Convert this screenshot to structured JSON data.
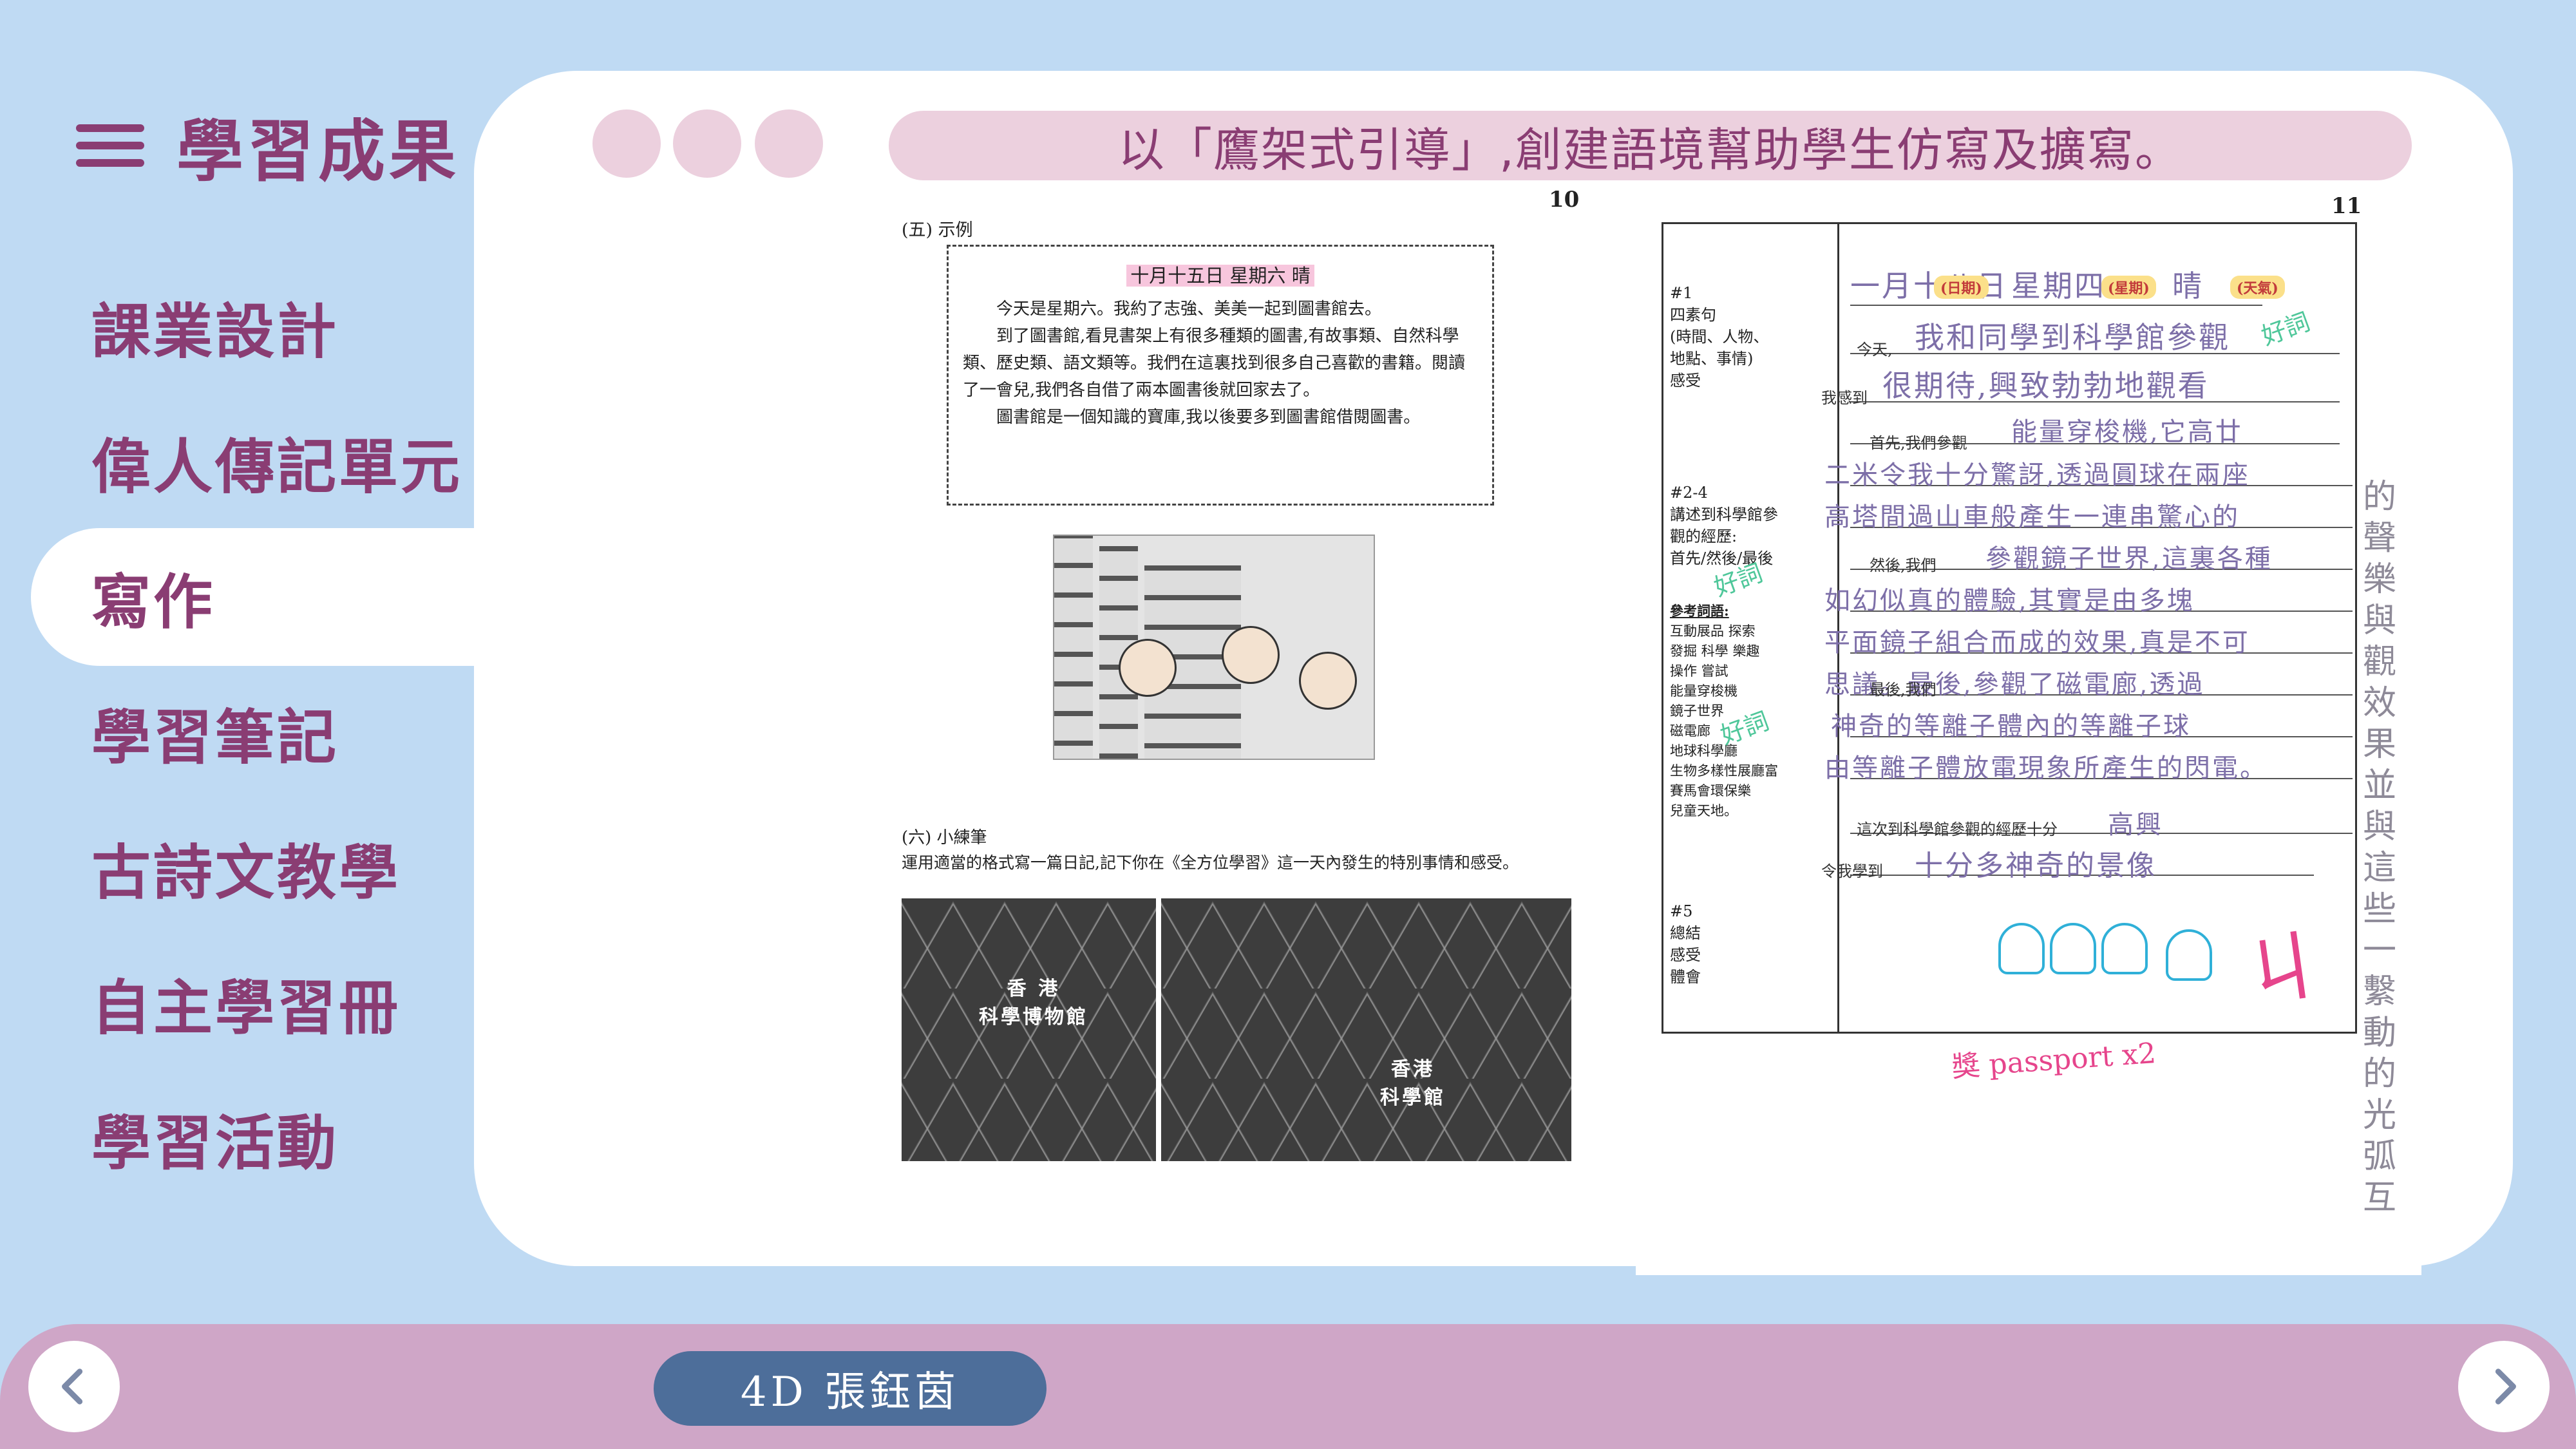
{
  "sidebar": {
    "title": "學習成果",
    "items": [
      {
        "label": "課業設計"
      },
      {
        "label": "偉人傳記單元"
      },
      {
        "label": "寫作",
        "active": true
      },
      {
        "label": "學習筆記"
      },
      {
        "label": "古詩文教學"
      },
      {
        "label": "自主學習冊"
      },
      {
        "label": "學習活動"
      }
    ]
  },
  "panel": {
    "caption": "以「鷹架式引導」,創建語境幫助學生仿寫及擴寫。"
  },
  "left_page": {
    "page_number": "10",
    "section_5_label": "(五) 示例",
    "sample_date": "十月十五日 星期六 晴",
    "sample_paragraphs": [
      "今天是星期六。我約了志強、美美一起到圖書館去。",
      "到了圖書館,看見書架上有很多種類的圖書,有故事類、自然科學類、歷史類、語文類等。我們在這裏找到很多自己喜歡的書籍。閱讀了一會兒,我們各自借了兩本圖書後就回家去了。",
      "圖書館是一個知識的寶庫,我以後要多到圖書館借閱圖書。"
    ],
    "section_6_label": "(六) 小練筆",
    "exercise_instruction": "運用適當的格式寫一篇日記,記下你在《全方位學習》這一天內發生的特別事情和感受。",
    "photo_captions": [
      "香 港\n科學博物館",
      "香港\n科學館"
    ]
  },
  "right_page": {
    "page_number": "11",
    "guide": {
      "g1_title": "#1",
      "g1_body": "四素句\n(時間、人物、\n地點、事情)\n感受",
      "g2_title": "#2-4",
      "g2_body": "講述到科學館參\n觀的經歷:\n首先/然後/最後",
      "vocab_title": "參考詞語:",
      "vocab_body": "互動展品 探索\n發掘 科學 樂趣\n操作 嘗試\n能量穿梭機\n鏡子世界\n磁電廊\n地球科學廳\n生物多樣性展廳富\n賽馬會環保樂\n兒童天地。",
      "g5_title": "#5",
      "g5_body": "總結\n感受\n體會"
    },
    "tags": [
      "(日期)",
      "(星期)",
      "(天氣)"
    ],
    "handwriting": {
      "date_line": "一月十八日",
      "weekday": "星期四",
      "weather": "晴",
      "today_prefix": "今天,",
      "today": "我和同學到科學館參觀",
      "feel_prefix": "我感到",
      "feel": "很期待,興致勃勃地觀看",
      "line3": "能量穿梭機,它高廿",
      "first_prefix": "首先,我們參觀",
      "line4": "二米令我十分驚訝,透過圓球在兩座",
      "line5": "高塔間過山車般產生一連串驚心的",
      "then_prefix": "然後,我們",
      "line6": "參觀鏡子世界,這裏各種",
      "line7": "如幻似真的體驗,其實是由多塊",
      "line8": "平面鏡子組合而成的效果,真是不可",
      "line9": "思議。最後,參觀了磁電廊,透過",
      "last_prefix": "最後,我們",
      "line10": "神奇的等離子體內的等離子球",
      "line11": "由等離子體放電現象所產生的閃電。",
      "sum_prefix": "這次到科學館參觀的經歷十分",
      "sum": "高興",
      "learn_prefix": "令我學到",
      "learn": "十分多神奇的景像"
    },
    "annotations": {
      "good_word_label": "好詞",
      "reward_note": "獎 passport x2",
      "margin_note": "的聲樂與觀效果並與這些一繫動的光弧互"
    }
  },
  "footer": {
    "student": "4D 張鈺茵"
  },
  "colors": {
    "background": "#bfdaf3",
    "accent": "#8a3d73",
    "pill": "#ecd0de",
    "bottom_bar": "#cfa6c7",
    "student_pill": "#4d6e9a"
  }
}
